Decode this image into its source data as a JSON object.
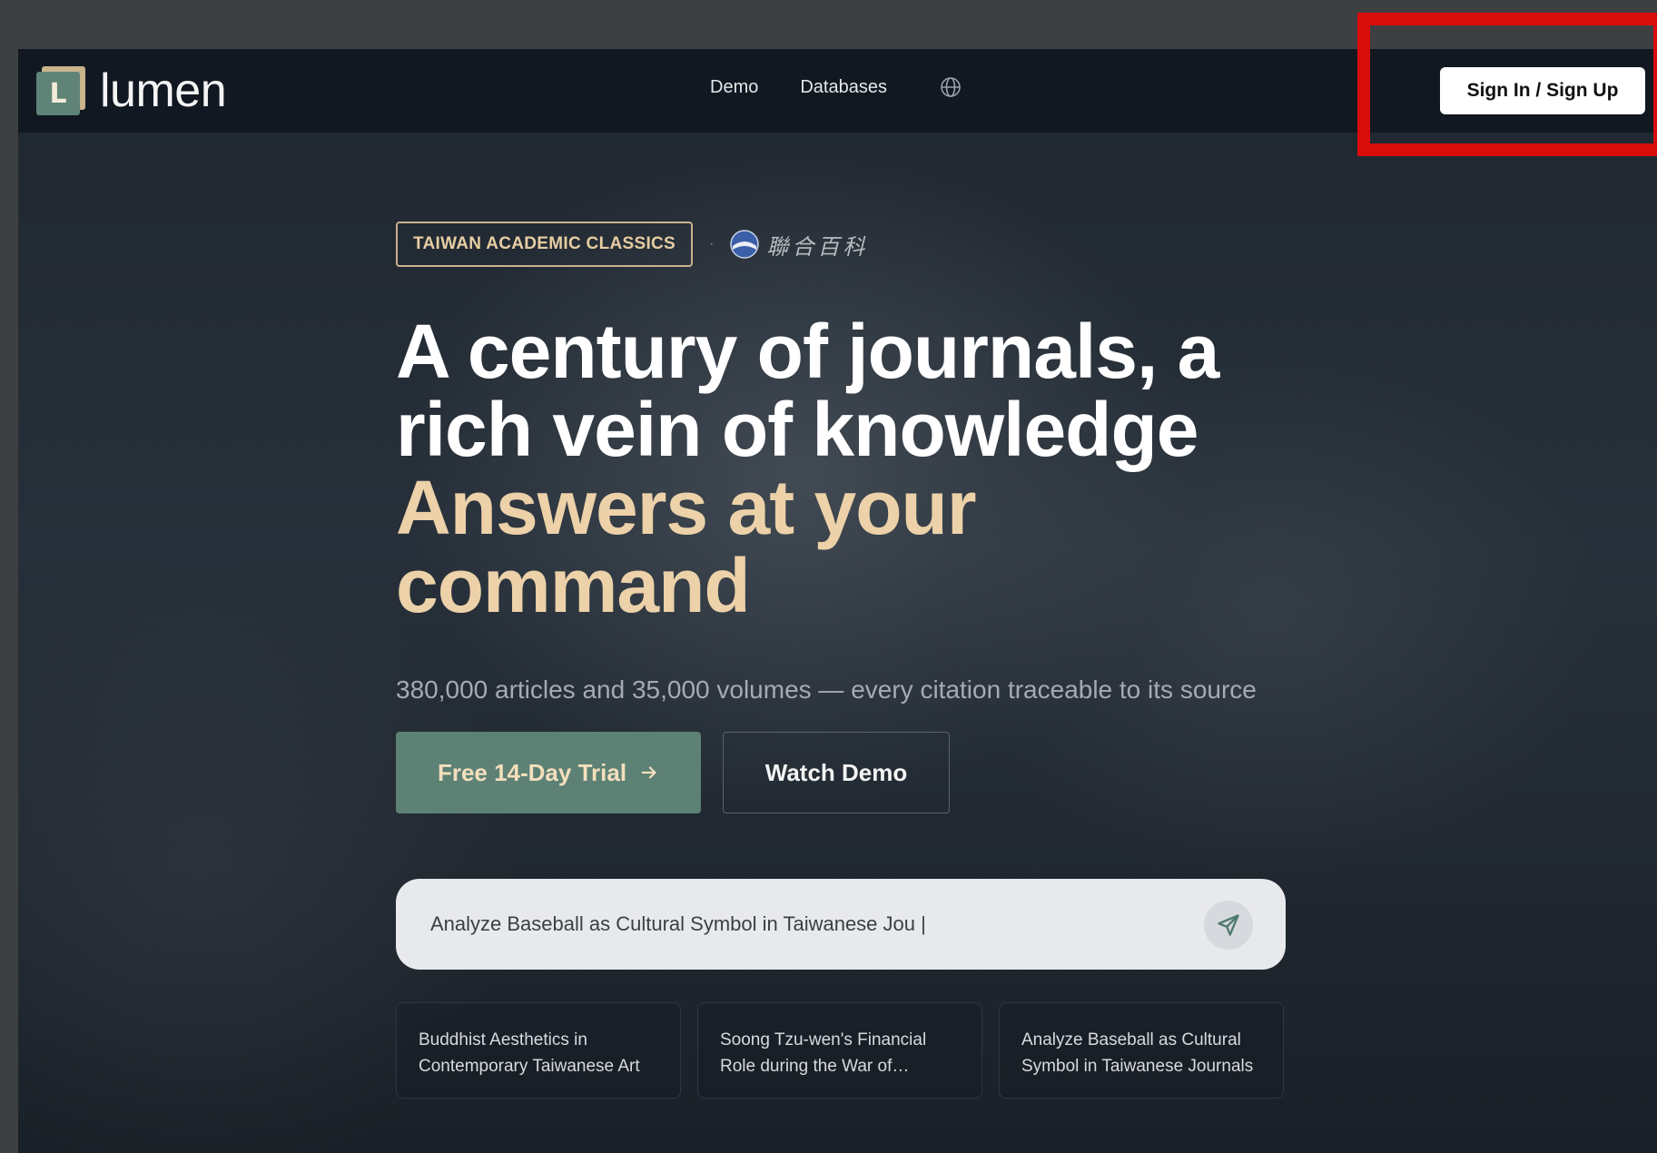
{
  "brand": {
    "name": "lumen",
    "mark_letter": "L"
  },
  "nav": {
    "links": [
      {
        "label": "Demo"
      },
      {
        "label": "Databases"
      }
    ],
    "signin_label": "Sign In / Sign Up"
  },
  "hero": {
    "badge": "TAIWAN ACADEMIC CLASSICS",
    "partner_text": "聯合百科",
    "headline_line1": "A century of journals, a rich vein of knowledge",
    "headline_line2": "Answers at your command",
    "subtitle": "380,000 articles and 35,000 volumes — every citation traceable to its source",
    "primary_cta": "Free 14-Day Trial",
    "secondary_cta": "Watch Demo"
  },
  "search": {
    "value": "Analyze Baseball as Cultural Symbol in Taiwanese Jou |"
  },
  "suggestions": [
    {
      "text": "Buddhist Aesthetics in Contemporary Taiwanese Art"
    },
    {
      "text": "Soong Tzu-wen's Financial Role during the War of Resistance"
    },
    {
      "text": "Analyze Baseball as Cultural Symbol in Taiwanese Journals"
    }
  ],
  "colors": {
    "accent_gold": "#ecd1a9",
    "accent_green": "#5d8174",
    "highlight_red": "#d90c0c"
  },
  "icons": [
    "globe-icon",
    "arrow-right-icon",
    "send-icon",
    "partner-logo-icon"
  ]
}
